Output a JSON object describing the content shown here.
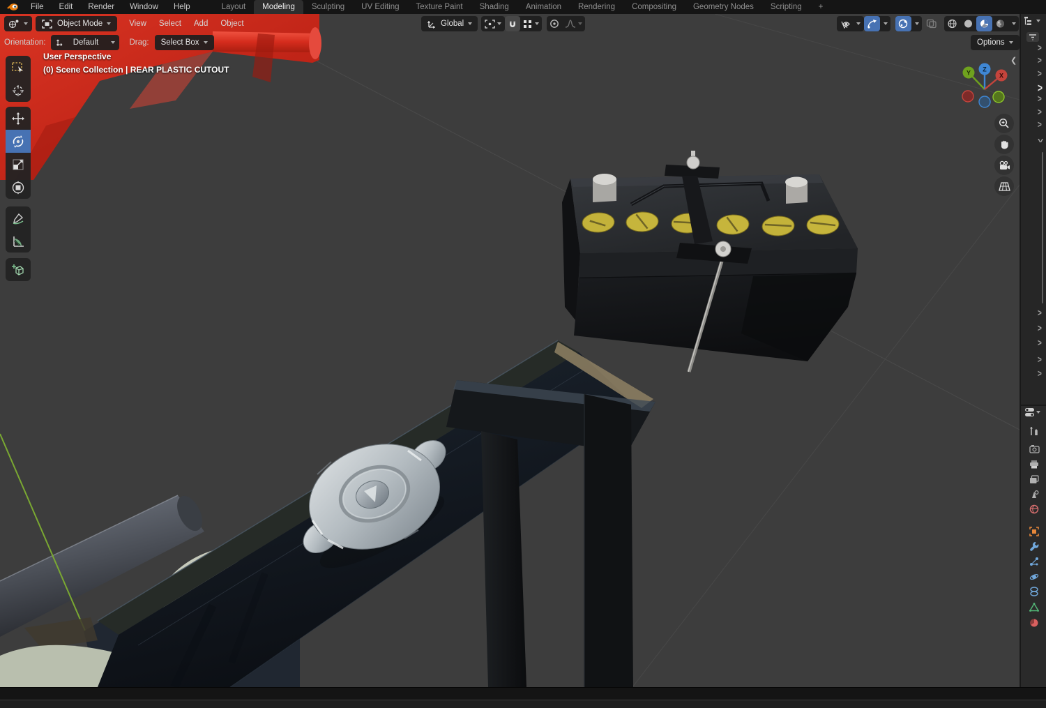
{
  "topbar": {
    "menus": [
      {
        "label": "File"
      },
      {
        "label": "Edit"
      },
      {
        "label": "Render"
      },
      {
        "label": "Window"
      },
      {
        "label": "Help"
      }
    ],
    "tabs": [
      {
        "label": "Layout",
        "active": false
      },
      {
        "label": "Modeling",
        "active": true
      },
      {
        "label": "Sculpting",
        "active": false
      },
      {
        "label": "UV Editing",
        "active": false
      },
      {
        "label": "Texture Paint",
        "active": false
      },
      {
        "label": "Shading",
        "active": false
      },
      {
        "label": "Animation",
        "active": false
      },
      {
        "label": "Rendering",
        "active": false
      },
      {
        "label": "Compositing",
        "active": false
      },
      {
        "label": "Geometry Nodes",
        "active": false
      },
      {
        "label": "Scripting",
        "active": false
      }
    ],
    "add_tab_label": "+"
  },
  "tool_header": {
    "mode_value": "Object Mode",
    "menus": [
      "View",
      "Select",
      "Add",
      "Object"
    ],
    "transform_orientation_value": "Global",
    "right_icons": [
      "show-object-types",
      "gizmos-toggle",
      "overlays-toggle",
      "xray-toggle"
    ],
    "shading_modes": [
      "wireframe",
      "solid",
      "material-preview",
      "rendered"
    ],
    "active_shading_mode": "material-preview",
    "options_label": "Options"
  },
  "tool_settings": {
    "orientation_label": "Orientation:",
    "orientation_value": "Default",
    "drag_label": "Drag:",
    "drag_value": "Select Box"
  },
  "viewport_overlay": {
    "view_name": "User Perspective",
    "context_path": "(0) Scene Collection | REAR PLASTIC CUTOUT",
    "axis_labels": {
      "x": "X",
      "y": "Y",
      "z": "Z"
    }
  },
  "toolbar": {
    "active_tool": "rotate",
    "tools": [
      "select-box",
      "cursor",
      "move",
      "rotate",
      "scale",
      "transform",
      "annotate",
      "measure",
      "add-cube"
    ]
  },
  "nav_buttons": [
    "zoom",
    "pan",
    "camera-view",
    "orthographic-toggle"
  ],
  "properties_tabs": [
    "tool",
    "render",
    "output",
    "view-layer",
    "scene",
    "world",
    "object",
    "modifiers",
    "particles",
    "physics",
    "constraints",
    "object-data",
    "material"
  ],
  "colors": {
    "accent": "#4772b3",
    "viewport_bg": "#3d3d3d",
    "object_red": "#cc2a1c",
    "battery_cap_yellow": "#c3b23a",
    "axis_x": "#c4443c",
    "axis_y": "#6fa21e",
    "axis_z": "#3f87d4",
    "annotation_green": "#7aa832",
    "tab_object_orange": "#e8883a",
    "tab_data_green": "#53b576",
    "tab_world_red": "#d96f6f",
    "tab_modifier_blue": "#71a8dc"
  }
}
